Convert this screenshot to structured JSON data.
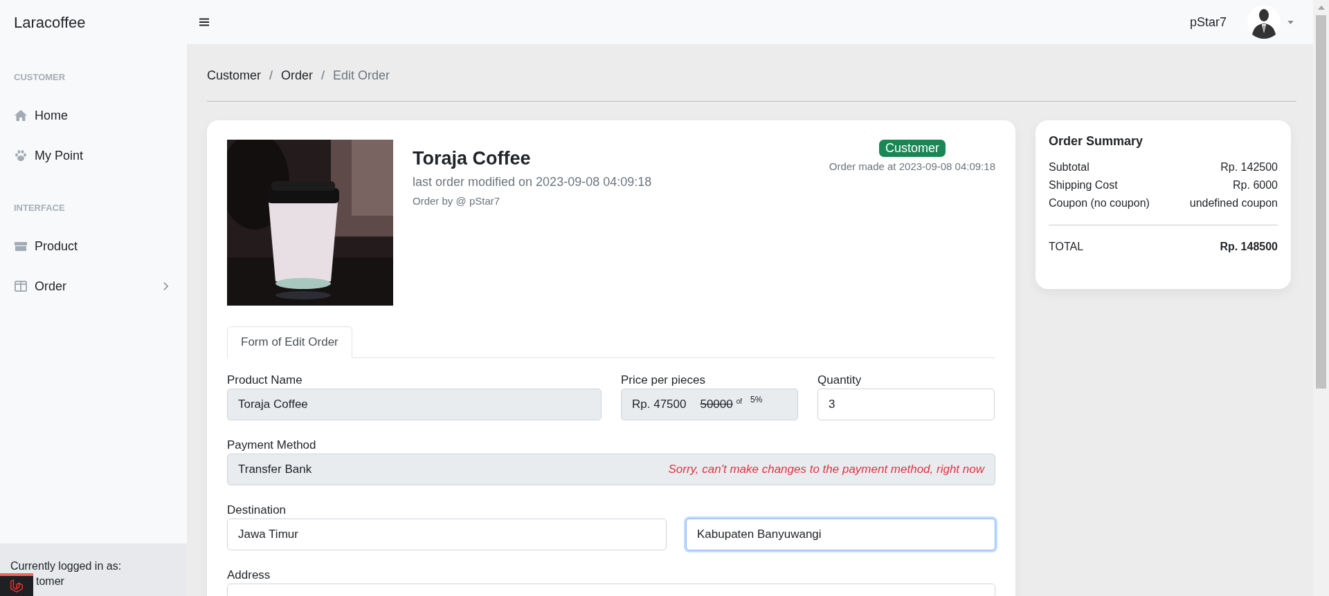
{
  "brand": "Laracoffee",
  "header": {
    "user": "pStar7"
  },
  "sidebar": {
    "sections": [
      {
        "heading": "CUSTOMER",
        "items": [
          {
            "label": "Home",
            "expandable": false
          },
          {
            "label": "My Point",
            "expandable": false
          }
        ]
      },
      {
        "heading": "INTERFACE",
        "items": [
          {
            "label": "Product",
            "expandable": false
          },
          {
            "label": "Order",
            "expandable": true
          }
        ]
      }
    ],
    "footer": {
      "label": "Currently logged in as:",
      "role": "tomer"
    }
  },
  "breadcrumb": [
    {
      "label": "Customer",
      "current": false
    },
    {
      "separator": "/",
      "label": "Order",
      "current": false
    },
    {
      "separator": "/",
      "label": "Edit Order",
      "current": true
    }
  ],
  "product": {
    "kind": "picture",
    "title": "Toraja Coffee",
    "modified": "last order modified on 2023-09-08 04:09:18",
    "order_by": "Order by @ pStar7",
    "badge": "Customer",
    "made_at": "Order made at 2023-09-08 04:09:18"
  },
  "tabs": [
    {
      "label": "Form of Edit Order",
      "selected": true
    }
  ],
  "form": {
    "product_name": {
      "label": "Product Name",
      "value": "Toraja Coffee",
      "disabled": true
    },
    "price": {
      "label": "Price per pieces",
      "value": "Rp. 47500",
      "original": "50000",
      "of": "of",
      "discount": "5%"
    },
    "quantity": {
      "label": "Quantity",
      "value": "3",
      "disabled": false
    },
    "payment": {
      "label": "Payment Method",
      "value": "Transfer Bank",
      "note": "Sorry, can't make changes to the payment method, right now",
      "disabled": true
    },
    "destination": {
      "label": "Destination",
      "fields": [
        {
          "value": "Jawa Timur",
          "focused": false
        },
        {
          "value": "Kabupaten Banyuwangi",
          "focused": true
        }
      ]
    },
    "address": {
      "label": "Address"
    }
  },
  "summary": {
    "title": "Order Summary",
    "rows": [
      {
        "label": "Subtotal",
        "value": "Rp. 142500"
      },
      {
        "label": "Shipping Cost",
        "value": "Rp. 6000"
      },
      {
        "label": "Coupon (no coupon)",
        "value": "undefined coupon"
      }
    ],
    "total_label": "TOTAL",
    "total_value": "Rp. 148500"
  }
}
